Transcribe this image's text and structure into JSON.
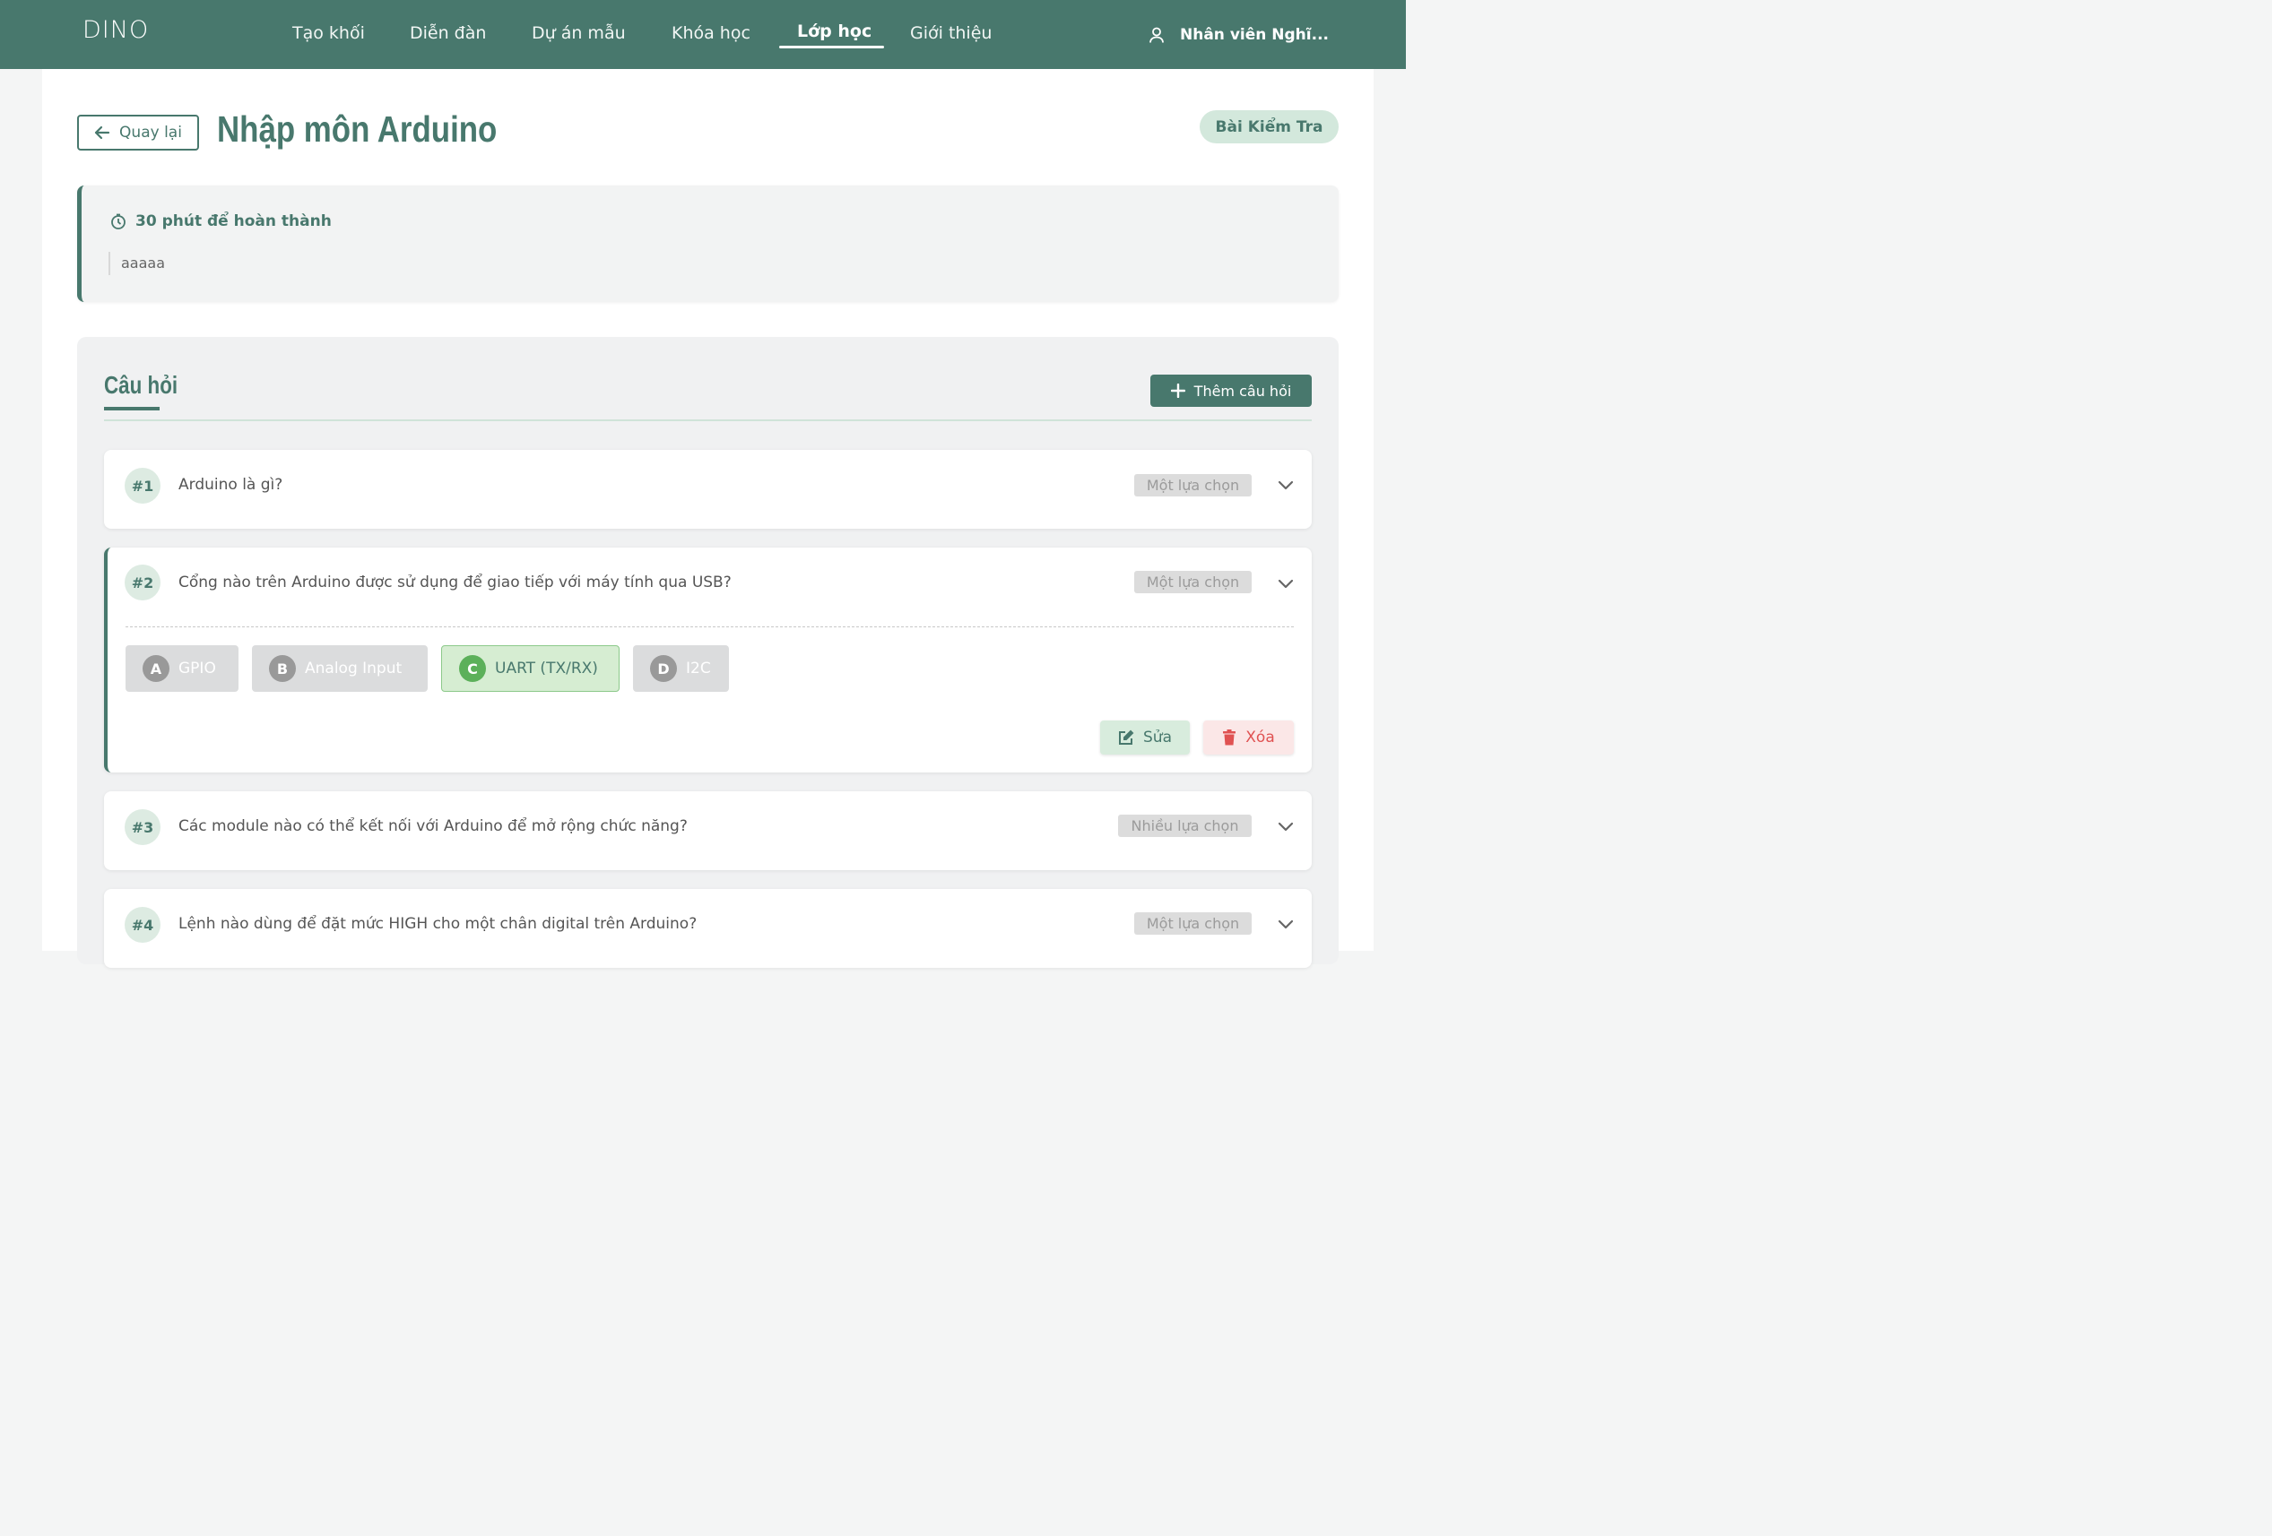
{
  "brand": {
    "logo_text": "DINO"
  },
  "nav": {
    "items": [
      {
        "label": "Tạo khối"
      },
      {
        "label": "Diễn đàn"
      },
      {
        "label": "Dự án mẫu"
      },
      {
        "label": "Khóa học"
      },
      {
        "label": "Lớp học",
        "active": true
      },
      {
        "label": "Giới thiệu"
      }
    ],
    "user_name": "Nhân viên Nghĩ..."
  },
  "header": {
    "back_label": "Quay lại",
    "title": "Nhập môn Arduino",
    "badge": "Bài Kiểm Tra"
  },
  "info": {
    "time_label": "30 phút để hoàn thành",
    "description": "aaaaa"
  },
  "questions_section": {
    "heading": "Câu hỏi",
    "add_label": "Thêm câu hỏi",
    "items": [
      {
        "number": "#1",
        "text": "Arduino là gì?",
        "type": "Một lựa chọn"
      },
      {
        "number": "#2",
        "text": "Cổng nào trên Arduino được sử dụng để giao tiếp với máy tính qua USB?",
        "type": "Một lựa chọn",
        "expanded": true,
        "options": [
          {
            "letter": "A",
            "text": "GPIO",
            "correct": false
          },
          {
            "letter": "B",
            "text": "Analog Input",
            "correct": false
          },
          {
            "letter": "C",
            "text": "UART (TX/RX)",
            "correct": true
          },
          {
            "letter": "D",
            "text": "I2C",
            "correct": false
          }
        ],
        "edit_label": "Sửa",
        "delete_label": "Xóa"
      },
      {
        "number": "#3",
        "text": "Các module nào có thể kết nối với Arduino để mở rộng chức năng?",
        "type": "Nhiều lựa chọn"
      },
      {
        "number": "#4",
        "text": "Lệnh nào dùng để đặt mức HIGH cho một chân digital trên Arduino?",
        "type": "Một lựa chọn"
      }
    ]
  },
  "colors": {
    "primary": "#48786d",
    "badge_bg": "#d3e8dc",
    "correct_bg": "#d6edd2",
    "danger": "#e05252"
  }
}
